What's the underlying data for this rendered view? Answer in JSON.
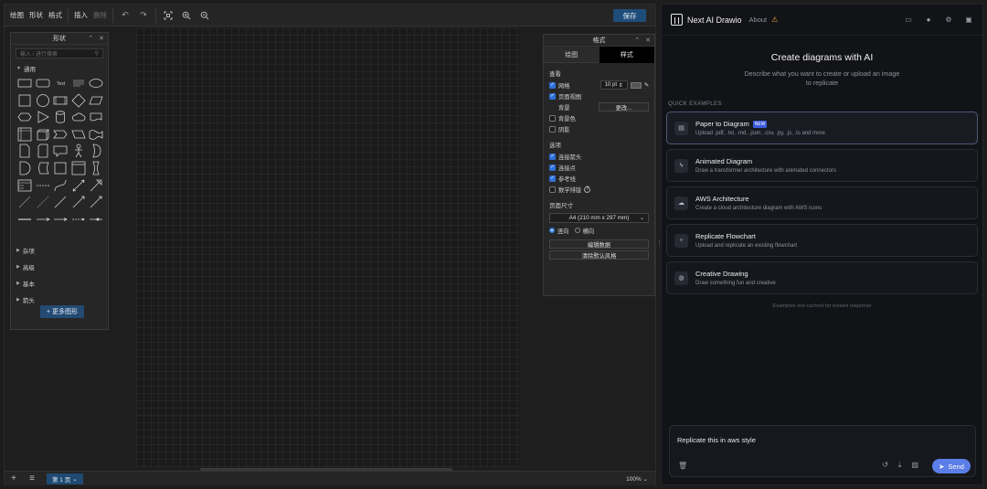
{
  "toolbar": {
    "menu": [
      "绘图",
      "形状",
      "格式"
    ],
    "insert": "插入",
    "delete": "删除",
    "save": "保存"
  },
  "shapes_panel": {
    "title": "形状",
    "search_placeholder": "输入 / 进行搜索",
    "category_general": "通用",
    "categories": [
      "杂项",
      "高级",
      "基本",
      "箭头"
    ],
    "more_shapes": "+ 更多图形"
  },
  "format_panel": {
    "title": "格式",
    "tabs": [
      "绘图",
      "样式"
    ],
    "view_section": "查看",
    "grid": "网格",
    "grid_size": "10 pt",
    "page_view": "页面视图",
    "background": "背景",
    "change": "更改...",
    "background_color": "背景色",
    "shadow": "阴影",
    "options_section": "选项",
    "connection_arrows": "连接箭头",
    "connection_points": "连接点",
    "guides": "参考线",
    "math_typesetting": "数学排版",
    "page_size_section": "页面尺寸",
    "page_size_value": "A4 (210 mm x 297 mm)",
    "portrait": "竖向",
    "landscape": "横向",
    "edit_data": "编辑数据",
    "clear_default_style": "清除默认风格"
  },
  "bottom_bar": {
    "page_tab": "第 1 页",
    "zoom": "100%"
  },
  "chat": {
    "app_title": "Next AI Drawio",
    "about": "About",
    "hero_title": "Create diagrams with AI",
    "hero_subtitle": "Describe what you want to create or upload an image to replicate",
    "quick_examples_label": "QUICK EXAMPLES",
    "examples": [
      {
        "title": "Paper to Diagram",
        "badge": "NEW",
        "desc": "Upload .pdf, .txt, .md, .json, .csv, .py, .js, .ts and more",
        "icon": "document-icon"
      },
      {
        "title": "Animated Diagram",
        "badge": "",
        "desc": "Draw a transformer architecture with animated connectors",
        "icon": "lightning-icon"
      },
      {
        "title": "AWS Architecture",
        "badge": "",
        "desc": "Create a cloud architecture diagram with AWS icons",
        "icon": "cloud-icon"
      },
      {
        "title": "Replicate Flowchart",
        "badge": "",
        "desc": "Upload and replicate an existing flowchart",
        "icon": "git-branch-icon"
      },
      {
        "title": "Creative Drawing",
        "badge": "",
        "desc": "Draw something fun and creative",
        "icon": "palette-icon"
      }
    ],
    "cached_note": "Examples are cached for instant response",
    "input_value": "Replicate this in aws style",
    "send": "Send"
  },
  "colors": {
    "accent": "#5b7ee8",
    "save_button": "#1f4d7a",
    "warning": "#e0a030"
  }
}
